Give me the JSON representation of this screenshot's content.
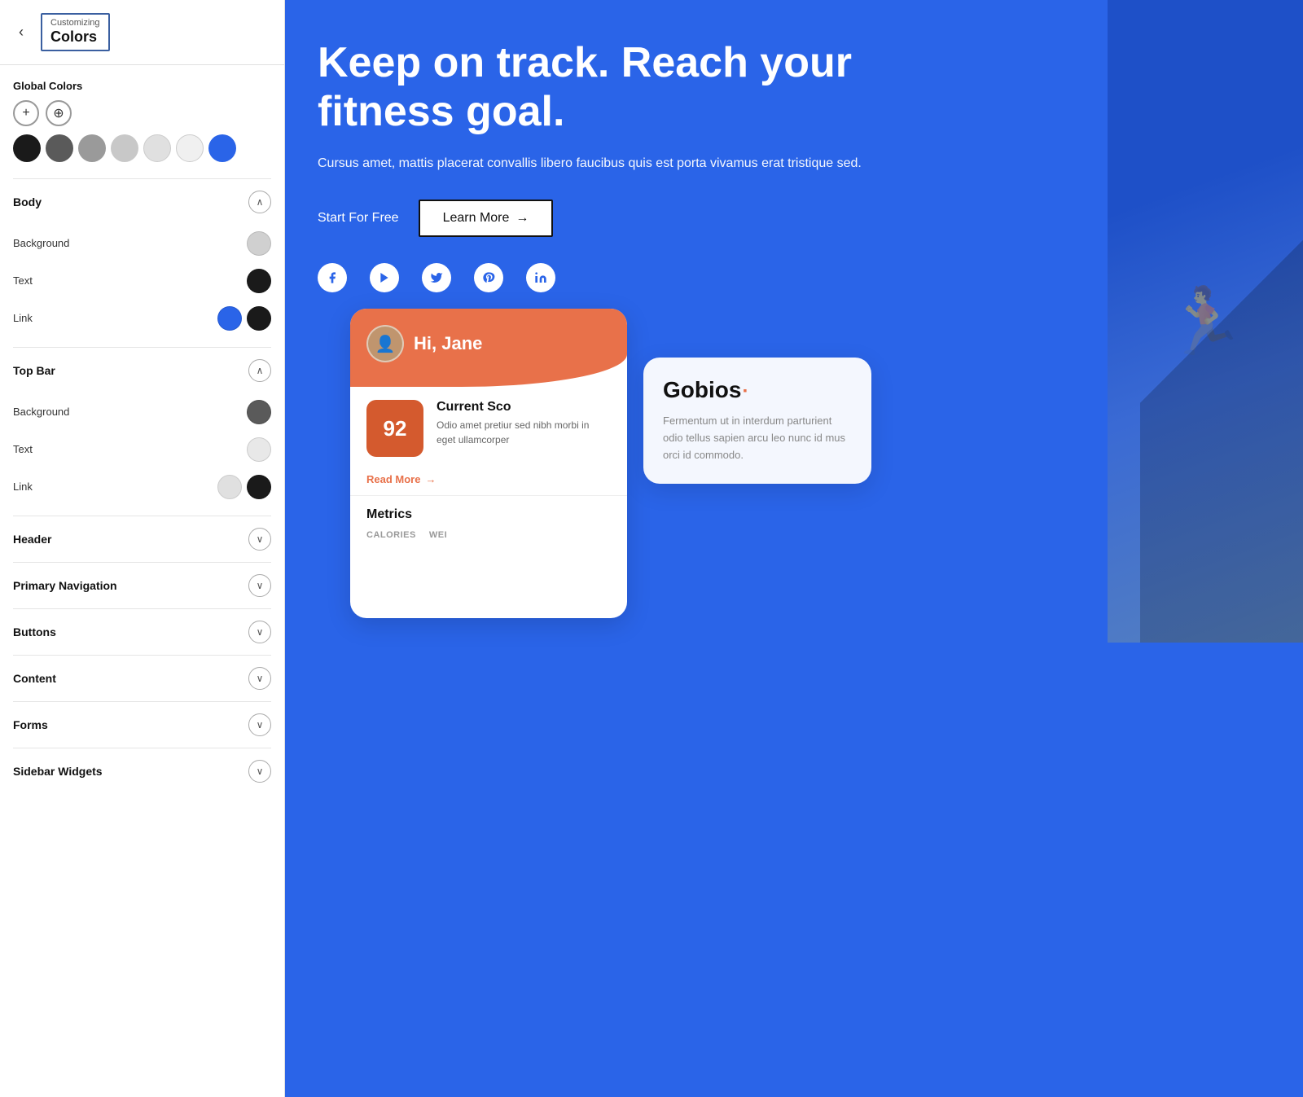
{
  "panel": {
    "back_label": "‹",
    "title_sub": "Customizing",
    "title_main": "Colors"
  },
  "global_colors": {
    "label": "Global Colors",
    "add_button_label": "+",
    "move_button_label": "⊕",
    "swatches": [
      {
        "color": "#1a1a1a",
        "name": "black"
      },
      {
        "color": "#5a5a5a",
        "name": "dark-gray"
      },
      {
        "color": "#9a9a9a",
        "name": "medium-gray"
      },
      {
        "color": "#c8c8c8",
        "name": "light-gray"
      },
      {
        "color": "#e0e0e0",
        "name": "lighter-gray"
      },
      {
        "color": "#f0f0f0",
        "name": "near-white"
      },
      {
        "color": "#2a64e8",
        "name": "blue"
      }
    ]
  },
  "sections": [
    {
      "id": "body",
      "label": "Body",
      "expanded": true,
      "chevron": "^",
      "rows": [
        {
          "label": "Background",
          "swatches": [
            {
              "color": "#d0d0d0"
            }
          ]
        },
        {
          "label": "Text",
          "swatches": [
            {
              "color": "#1a1a1a"
            }
          ]
        },
        {
          "label": "Link",
          "swatches": [
            {
              "color": "#2a64e8"
            },
            {
              "color": "#1a1a1a"
            }
          ]
        }
      ]
    },
    {
      "id": "top-bar",
      "label": "Top Bar",
      "expanded": true,
      "chevron": "^",
      "rows": [
        {
          "label": "Background",
          "swatches": [
            {
              "color": "#5a5a5a"
            }
          ]
        },
        {
          "label": "Text",
          "swatches": [
            {
              "color": "#e8e8e8"
            }
          ]
        },
        {
          "label": "Link",
          "swatches": [
            {
              "color": "#e0e0e0"
            },
            {
              "color": "#1a1a1a"
            }
          ]
        }
      ]
    },
    {
      "id": "header",
      "label": "Header",
      "expanded": false,
      "chevron": "˅",
      "rows": []
    },
    {
      "id": "primary-navigation",
      "label": "Primary Navigation",
      "expanded": false,
      "chevron": "˅",
      "rows": []
    },
    {
      "id": "buttons",
      "label": "Buttons",
      "expanded": false,
      "chevron": "˅",
      "rows": []
    },
    {
      "id": "content",
      "label": "Content",
      "expanded": false,
      "chevron": "˅",
      "rows": []
    },
    {
      "id": "forms",
      "label": "Forms",
      "expanded": false,
      "chevron": "˅",
      "rows": []
    },
    {
      "id": "sidebar-widgets",
      "label": "Sidebar Widgets",
      "expanded": false,
      "chevron": "˅",
      "rows": []
    }
  ],
  "preview": {
    "hero_title": "Keep on track. Reach your fitness goal.",
    "hero_subtitle": "Cursus amet, mattis placerat convallis libero faucibus quis est porta vivamus erat tristique sed.",
    "btn_start": "Start For Free",
    "btn_learn": "Learn More",
    "btn_learn_arrow": "→",
    "social_icons": [
      "f",
      "▶",
      "t",
      "P",
      "in"
    ],
    "card": {
      "greeting": "Hi, Jane",
      "score": "92",
      "score_title": "Current Sco",
      "score_desc": "Odio amet pretiur sed nibh morbi in eget ullamcorper",
      "read_more": "Read More",
      "read_more_arrow": "→",
      "metrics_title": "Metrics",
      "metrics": [
        "CALORIES",
        "WEI"
      ]
    },
    "gobios": {
      "name": "Gobios",
      "superscript": "▪",
      "desc": "Fermentum ut in interdum parturient odio tellus sapien arcu leo nunc id mus orci id commodo."
    }
  }
}
